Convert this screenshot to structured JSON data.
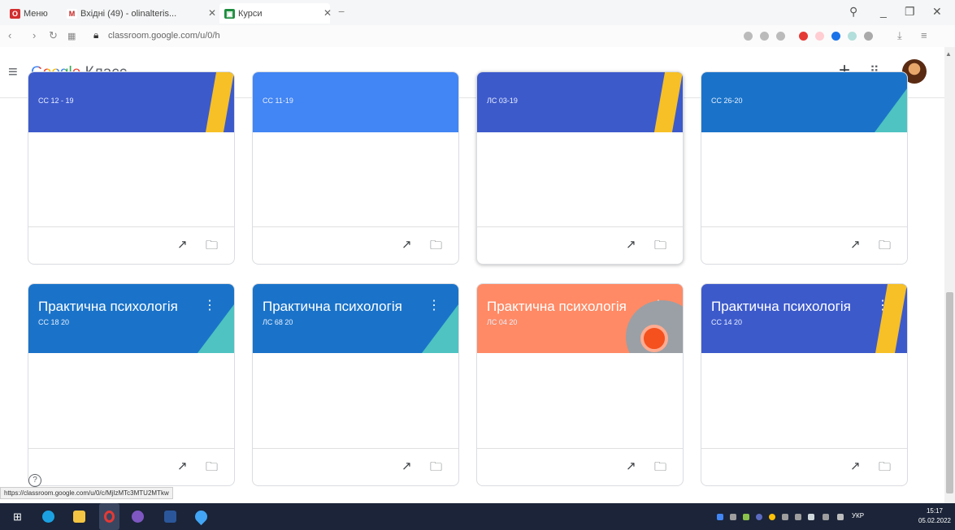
{
  "browser": {
    "tabs": [
      {
        "label": "Меню",
        "icon": "opera-icon",
        "color": "#d32f2f"
      },
      {
        "label": "Вхідні (49) - olinalteris...",
        "icon": "gmail-icon",
        "color": "#c5221f"
      },
      {
        "label": "Курси",
        "icon": "classroom-icon",
        "color": "#1e8e3e"
      }
    ],
    "url": "classroom.google.com/u/0/h",
    "status_url": "https://classroom.google.com/u/0/c/MjIzMTc3MTU2MTkw"
  },
  "app": {
    "title_google": "Google",
    "title_product": "Класс"
  },
  "courses": [
    {
      "title": "",
      "section": "СС 12 - 19",
      "color": "#3d5acb"
    },
    {
      "title": "",
      "section": "СС 11-19",
      "color": "#4285f4"
    },
    {
      "title": "",
      "section": "ЛС 03-19",
      "color": "#3d5acb"
    },
    {
      "title": "",
      "section": "СС 26-20",
      "color": "#1a73c9"
    },
    {
      "title": "Практична психологія",
      "section": "СС 18 20",
      "color": "#1a73c9"
    },
    {
      "title": "Практична психологія",
      "section": "ЛС 68 20",
      "color": "#1a73c9"
    },
    {
      "title": "Практична психологія",
      "section": "ЛС 04 20",
      "color": "#ff8a65"
    },
    {
      "title": "Практична психологія",
      "section": "СС 14 20",
      "color": "#3d5acb"
    }
  ],
  "footer_icons": [
    "trending-up-icon",
    "folder-icon"
  ],
  "taskbar": {
    "time": "15:17",
    "date": "05.02.2022",
    "lang": "УКР"
  }
}
